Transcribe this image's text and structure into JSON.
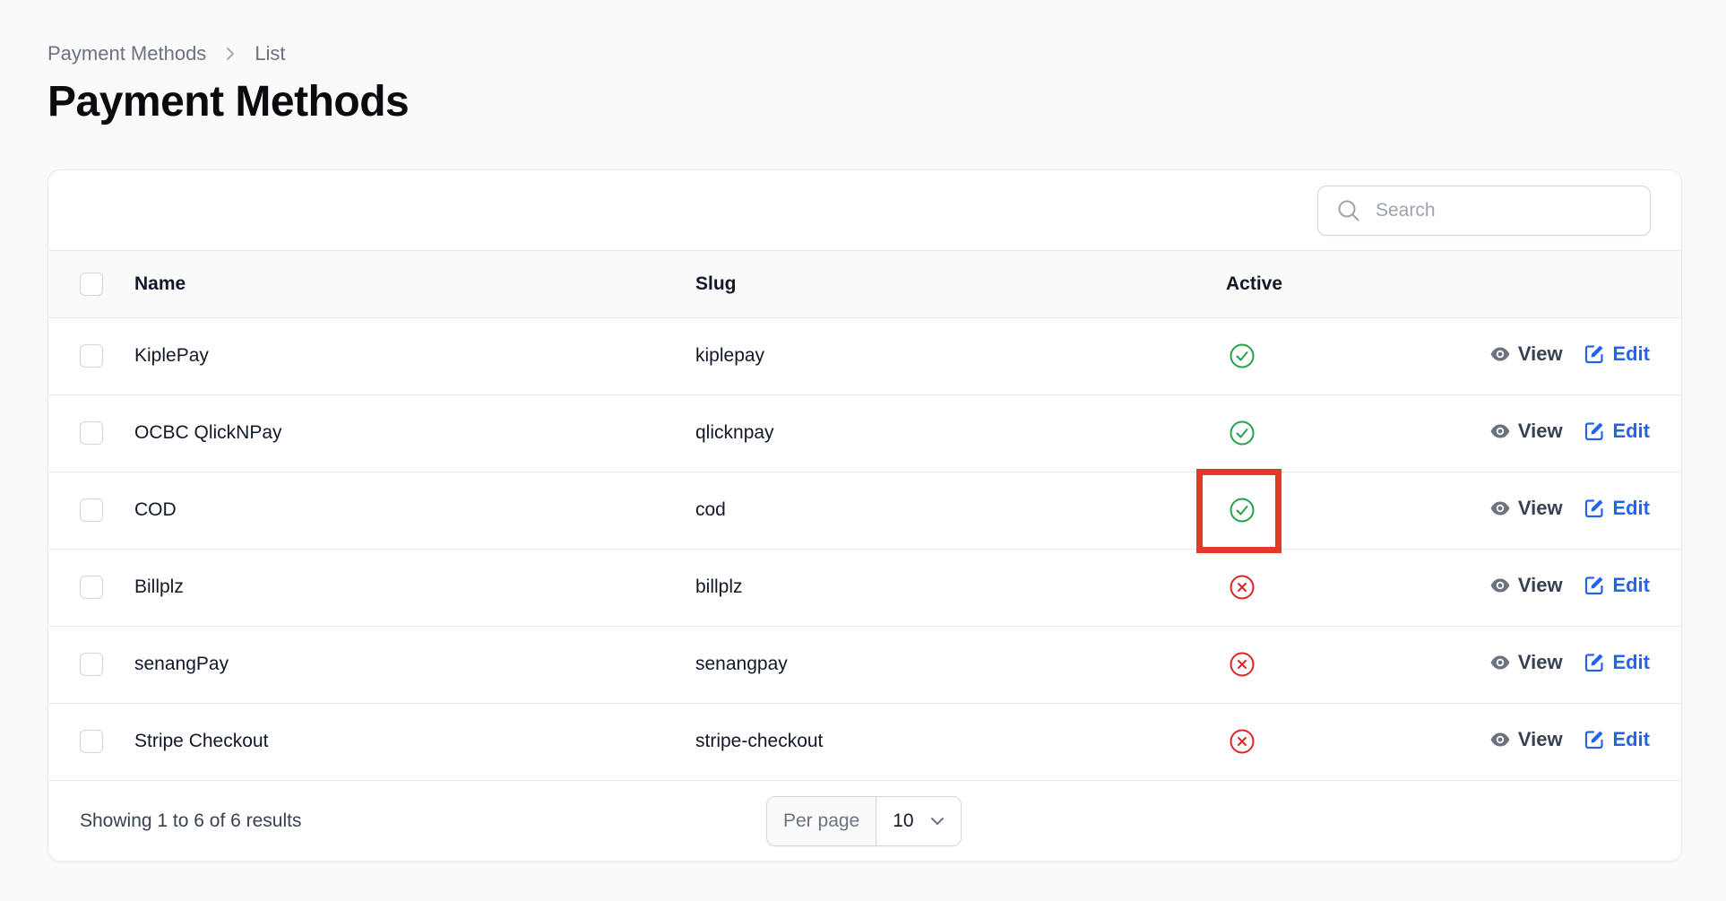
{
  "breadcrumb": {
    "parent": "Payment Methods",
    "current": "List"
  },
  "title": "Payment Methods",
  "search": {
    "placeholder": "Search",
    "value": ""
  },
  "table": {
    "headers": {
      "name": "Name",
      "slug": "Slug",
      "active": "Active"
    },
    "rows": [
      {
        "name": "KiplePay",
        "slug": "kiplepay",
        "active": true
      },
      {
        "name": "OCBC QlickNPay",
        "slug": "qlicknpay",
        "active": true
      },
      {
        "name": "COD",
        "slug": "cod",
        "active": true
      },
      {
        "name": "Billplz",
        "slug": "billplz",
        "active": false
      },
      {
        "name": "senangPay",
        "slug": "senangpay",
        "active": false
      },
      {
        "name": "Stripe Checkout",
        "slug": "stripe-checkout",
        "active": false
      }
    ],
    "actions": {
      "view": "View",
      "edit": "Edit"
    }
  },
  "footer": {
    "summary": "Showing 1 to 6 of 6 results",
    "per_page_label": "Per page",
    "per_page_value": "10"
  },
  "colors": {
    "active_green": "#22a34a",
    "inactive_red": "#dc2626",
    "edit_blue": "#2563eb",
    "highlight_red": "#e3392b"
  },
  "icons": {
    "breadcrumb_separator": "chevron-right-icon",
    "search": "search-icon",
    "active_true": "check-circle-icon",
    "active_false": "x-circle-icon",
    "view": "eye-icon",
    "edit": "pencil-square-icon",
    "select": "chevron-down-icon"
  }
}
